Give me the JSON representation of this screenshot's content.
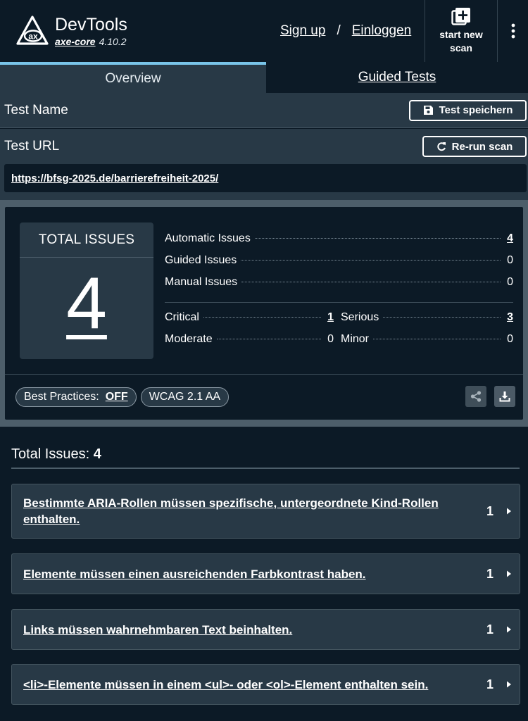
{
  "header": {
    "title": "DevTools",
    "core_name": "axe-core",
    "core_version": "4.10.2",
    "signup_label": "Sign up",
    "separator": "/",
    "login_label": "Einloggen",
    "new_scan_line1": "start new",
    "new_scan_line2": "scan"
  },
  "tabs": [
    {
      "label": "Overview",
      "active": true
    },
    {
      "label": "Guided Tests",
      "active": false
    }
  ],
  "test": {
    "name_label": "Test Name",
    "save_label": "Test speichern",
    "url_label": "Test URL",
    "rerun_label": "Re-run scan",
    "url": "https://bfsg-2025.de/barrierefreiheit-2025/"
  },
  "summary": {
    "total_label": "TOTAL ISSUES",
    "total_value": "4",
    "automatic_label": "Automatic Issues",
    "automatic_value": "4",
    "guided_label": "Guided Issues",
    "guided_value": "0",
    "manual_label": "Manual Issues",
    "manual_value": "0",
    "critical_label": "Critical",
    "critical_value": "1",
    "serious_label": "Serious",
    "serious_value": "3",
    "moderate_label": "Moderate",
    "moderate_value": "0",
    "minor_label": "Minor",
    "minor_value": "0",
    "best_practices_label": "Best Practices:",
    "best_practices_value": "OFF",
    "standard_label": "WCAG 2.1 AA"
  },
  "issues_list": {
    "heading": "Total Issues:",
    "heading_count": "4",
    "items": [
      {
        "text": "Bestimmte ARIA-Rollen müssen spezifische, untergeordnete Kind-Rollen enthalten.",
        "count": "1"
      },
      {
        "text": "Elemente müssen einen ausreichenden Farbkontrast haben.",
        "count": "1"
      },
      {
        "text": "Links müssen wahrnehmbaren Text beinhalten.",
        "count": "1"
      },
      {
        "text": "<li>-Elemente müssen in einem <ul>- oder <ol>-Element enthalten sein.",
        "count": "1"
      }
    ]
  },
  "colors": {
    "background": "#0c1a26",
    "panel": "#283946",
    "accent_tab": "#79c4e8"
  }
}
